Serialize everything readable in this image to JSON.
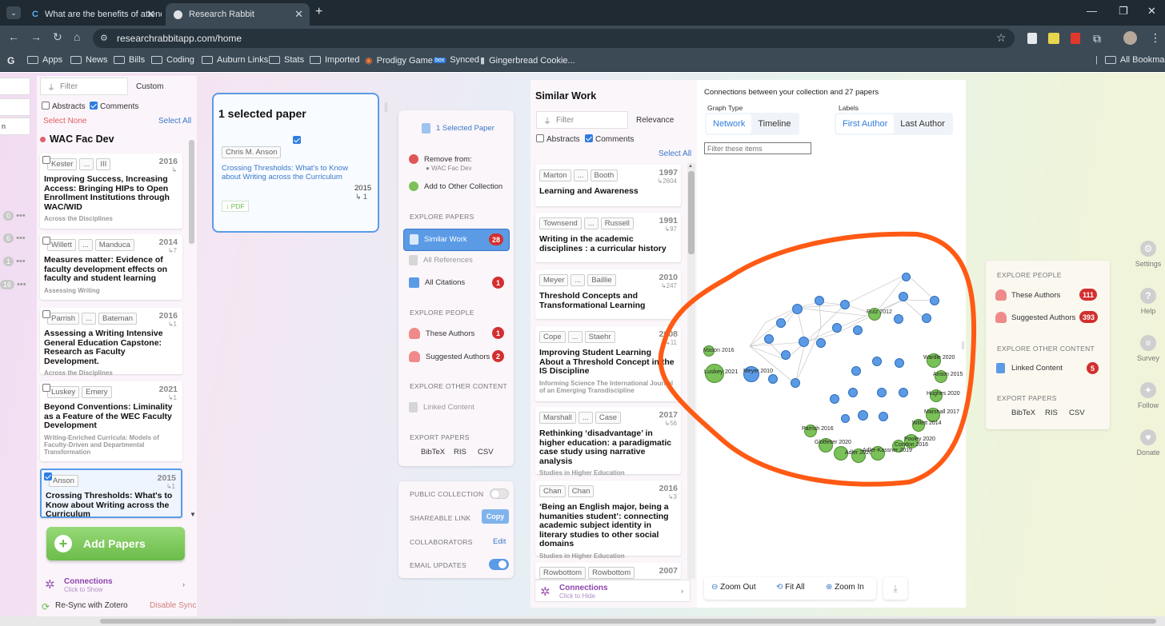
{
  "browser": {
    "tabs": [
      {
        "title": "What are the benefits of attend",
        "active": false
      },
      {
        "title": "Research Rabbit",
        "active": true
      }
    ],
    "url": "researchrabbitapp.com/home",
    "bookmarks": [
      "Apps",
      "News",
      "Bills",
      "Coding",
      "Auburn Links",
      "Stats",
      "Imported",
      "Prodigy Game",
      "Synced",
      "Gingerbread Cookie..."
    ],
    "all_bookmarks": "All Bookmarks"
  },
  "left_strip": {
    "counts": [
      "0",
      "6",
      "1",
      "16"
    ]
  },
  "collection": {
    "filter_placeholder": "Filter",
    "custom": "Custom",
    "abstracts": "Abstracts",
    "comments": "Comments",
    "select_none": "Select None",
    "select_all": "Select All",
    "name": "WAC Fac Dev",
    "papers": [
      {
        "authors": [
          "Kester",
          "...",
          "III"
        ],
        "year": "2016",
        "cites": "",
        "title": "Improving Success, Increasing Access: Bringing HIPs to Open Enrollment Institutions through WAC/WID",
        "venue": "Across the Disciplines",
        "checked": false
      },
      {
        "authors": [
          "Willett",
          "...",
          "Manduca"
        ],
        "year": "2014",
        "cites": "↳7",
        "title": "Measures matter: Evidence of faculty development effects on faculty and student learning",
        "venue": "Assessing Writing",
        "checked": false
      },
      {
        "authors": [
          "Parrish",
          "...",
          "Bateman"
        ],
        "year": "2016",
        "cites": "↳1",
        "title": "Assessing a Writing Intensive General Education Capstone: Research as Faculty Development.",
        "venue": "Across the Disciplines",
        "checked": false
      },
      {
        "authors": [
          "Luskey",
          "Emery"
        ],
        "year": "2021",
        "cites": "↳1",
        "title": "Beyond Conventions: Liminality as a Feature of the WEC Faculty Development",
        "venue": "Writing-Enriched Curricula: Models of Faculty-Driven and Departmental Transformation",
        "checked": false
      },
      {
        "authors": [
          "Anson"
        ],
        "year": "2015",
        "cites": "↳1",
        "title": "Crossing Thresholds: What's to Know about Writing across the Curriculum",
        "venue": "",
        "checked": true
      }
    ],
    "add_papers": "Add Papers",
    "connections_title": "Connections",
    "connections_sub": "Click to Show",
    "resync": "Re-Sync with Zotero",
    "disable_sync": "Disable Sync"
  },
  "selected": {
    "heading": "1 selected paper",
    "author": "Chris M. Anson",
    "title": "Crossing Thresholds: What's to Know about Writing across the Curriculum",
    "year": "2015",
    "cites": "↳ 1",
    "pdf": "↓ PDF"
  },
  "menu": {
    "selected_paper": "1 Selected Paper",
    "remove_from": "Remove from:",
    "remove_collection": "WAC Fac Dev",
    "add_to_other": "Add to Other Collection",
    "explore_papers": "EXPLORE PAPERS",
    "similar_work": "Similar Work",
    "similar_count": "28",
    "all_references": "All References",
    "all_citations": "All Citations",
    "citations_count": "1",
    "explore_people": "EXPLORE PEOPLE",
    "these_authors": "These Authors",
    "these_authors_count": "1",
    "suggested_authors": "Suggested Authors",
    "suggested_count": "2",
    "explore_other": "EXPLORE OTHER CONTENT",
    "linked_content": "Linked Content",
    "export_papers": "EXPORT PAPERS",
    "bibtex": "BibTeX",
    "ris": "RIS",
    "csv": "CSV"
  },
  "settings_panel": {
    "public_collection": "PUBLIC COLLECTION",
    "shareable_link": "SHAREABLE LINK",
    "copy": "Copy",
    "collaborators": "COLLABORATORS",
    "edit": "Edit",
    "email_updates": "EMAIL UPDATES"
  },
  "similar": {
    "heading": "Similar Work",
    "filter_placeholder": "Filter",
    "relevance": "Relevance",
    "abstracts": "Abstracts",
    "comments": "Comments",
    "select_all": "Select All",
    "papers": [
      {
        "authors": [
          "Marton",
          "...",
          "Booth"
        ],
        "year": "1997",
        "cites": "↳2604",
        "title": "Learning and Awareness",
        "venue": ""
      },
      {
        "authors": [
          "Townsend",
          "...",
          "Russell"
        ],
        "year": "1991",
        "cites": "↳97",
        "title": "Writing in the academic disciplines : a curricular history",
        "venue": ""
      },
      {
        "authors": [
          "Meyer",
          "...",
          "Baillie"
        ],
        "year": "2010",
        "cites": "↳247",
        "title": "Threshold Concepts and Transformational Learning",
        "venue": ""
      },
      {
        "authors": [
          "Cope",
          "...",
          "Staehr"
        ],
        "year": "2008",
        "cites": "↳11",
        "title": "Improving Student Learning About a Threshold Concept in the IS Discipline",
        "venue": "Informing Science The International Journal of an Emerging Transdiscipline"
      },
      {
        "authors": [
          "Marshall",
          "...",
          "Case"
        ],
        "year": "2017",
        "cites": "↳56",
        "title": "Rethinking ‘disadvantage’ in higher education: a paradigmatic case study using narrative analysis",
        "venue": "Studies in Higher Education"
      },
      {
        "authors": [
          "Chan",
          "Chan"
        ],
        "year": "2016",
        "cites": "↳3",
        "title": "‘Being an English major, being a humanities student’: connecting academic subject identity in literary studies to other social domains",
        "venue": "Studies in Higher Education"
      },
      {
        "authors": [
          "Rowbottom",
          "Rowbottom"
        ],
        "year": "2007",
        "cites": "",
        "title": "",
        "venue": ""
      }
    ],
    "connections_title": "Connections",
    "connections_sub": "Click to Hide"
  },
  "graph": {
    "heading": "Connections between your collection and 27 papers",
    "graph_type": "Graph Type",
    "network": "Network",
    "timeline": "Timeline",
    "labels": "Labels",
    "first_author": "First Author",
    "last_author": "Last Author",
    "filter_placeholder": "Filter these items",
    "zoom_out": "Zoom Out",
    "fit_all": "Fit All",
    "zoom_in": "Zoom In",
    "green_labels": [
      "Rutz 2012",
      "Luskey 2021",
      "Mason 2016",
      "Wardle 2020",
      "Anson 2015",
      "Hughes 2020",
      "Marshall 2017",
      "Willett 2014",
      "Parrish 2016",
      "Glotfelter 2020",
      "Condon 2016",
      "Adler-Kassner 2019",
      "Pooley 2020",
      "Adler 2020"
    ],
    "blue_labels": [
      "Meyer 2010"
    ],
    "highlight_color": "#ff5a14"
  },
  "right_panel": {
    "explore_people": "EXPLORE PEOPLE",
    "these_authors": "These Authors",
    "these_authors_count": "111",
    "suggested_authors": "Suggested Authors",
    "suggested_count": "393",
    "explore_other": "EXPLORE OTHER CONTENT",
    "linked_content": "Linked Content",
    "linked_count": "5",
    "export_papers": "EXPORT PAPERS",
    "bibtex": "BibTeX",
    "ris": "RIS",
    "csv": "CSV"
  },
  "right_side": [
    "Settings",
    "Help",
    "Survey",
    "Follow",
    "Donate"
  ],
  "colors": {
    "accent_blue": "#2f7de1",
    "badge_red": "#d32f2f",
    "add_green": "#7ac158"
  }
}
